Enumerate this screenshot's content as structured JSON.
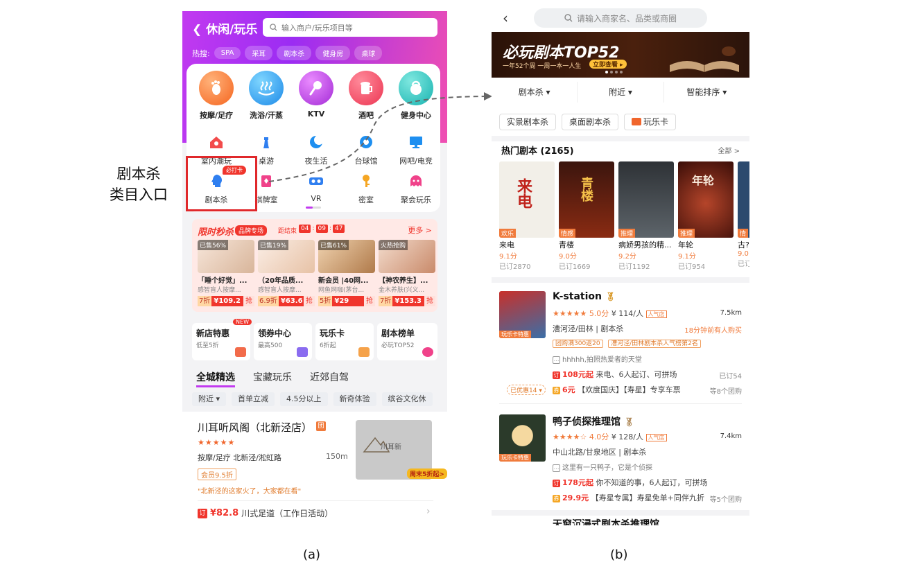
{
  "captions": {
    "left": "(a)",
    "right": "(b)"
  },
  "annotation": {
    "line1": "剧本杀",
    "line2": "类目入口"
  },
  "left": {
    "title": "休闲/玩乐",
    "search_placeholder": "输入商户/玩乐项目等",
    "hot_label": "热搜:",
    "hot_tags": [
      "SPA",
      "采耳",
      "剧本杀",
      "健身房",
      "桌球"
    ],
    "big_categories": [
      "按摩/足疗",
      "洗浴/汗蒸",
      "KTV",
      "酒吧",
      "健身中心"
    ],
    "small_row1": [
      "室内潮玩",
      "桌游",
      "夜生活",
      "台球馆",
      "网吧/电竞"
    ],
    "small_row2": [
      "剧本杀",
      "棋牌室",
      "VR",
      "密室",
      "聚会玩乐"
    ],
    "hot_badge": "必打卡",
    "flash": {
      "title": "限时秒杀",
      "brand": "品牌专场",
      "dist": "距结束",
      "time": [
        "04",
        "09",
        "47"
      ],
      "more": "更多 >",
      "deals": [
        {
          "sold": "已售56%",
          "t": "「睡个好觉」...",
          "s": "感智盲人按摩...",
          "d": "7折",
          "v": "¥109.2",
          "q": "抢"
        },
        {
          "sold": "已售19%",
          "t": "（20年品质...",
          "s": "感智盲人按摩...",
          "d": "6.9折",
          "v": "¥63.6",
          "q": "抢"
        },
        {
          "sold": "已售61%",
          "t": "新会员 |40网...",
          "s": "网鱼网咖(茅台...",
          "d": "5折",
          "v": "¥29",
          "q": "抢"
        },
        {
          "sold": "火热抢购",
          "t": "【神农养生】...",
          "s": "金木养肤(兴义...",
          "d": "7折",
          "v": "¥153.3",
          "q": "抢"
        }
      ]
    },
    "mini_cards": [
      {
        "t": "新店特惠",
        "s": "低至5折",
        "badge": "NEW"
      },
      {
        "t": "领券中心",
        "s": "最高500"
      },
      {
        "t": "玩乐卡",
        "s": "6折起"
      },
      {
        "t": "剧本榜单",
        "s": "必玩TOP52"
      }
    ],
    "tabs": [
      "全城精选",
      "宝藏玩乐",
      "近郊自驾"
    ],
    "filters": [
      "附近 ▾",
      "首单立减",
      "4.5分以上",
      "新奇体验",
      "缤谷文化休"
    ],
    "shop": {
      "name": "川耳听风阁（北新泾店）",
      "tuan": "团",
      "stars": "★★★★★",
      "category": "按摩/足疗 北新泾/淞虹路",
      "distance": "150m",
      "vip": "会员9.5折",
      "quote": "\"北新泾的这家火了，大家都在看\"",
      "img_logo": "川耳新",
      "weekend": "周末5折起>",
      "deal_price": "¥82.8",
      "deal_text": "川式足道（工作日活动）",
      "ding": "订"
    }
  },
  "right": {
    "search_placeholder": "请输入商家名、品类或商圈",
    "banner": {
      "title": "必玩剧本TOP52",
      "sub": "一年52个周 一周一本一人生",
      "btn": "立即查看 ▸"
    },
    "sort": [
      "剧本杀 ▾",
      "附近 ▾",
      "智能排序 ▾"
    ],
    "chips": [
      "实景剧本杀",
      "桌面剧本杀",
      "玩乐卡"
    ],
    "hot_title": "热门剧本 (2165)",
    "hot_all": "全部 >",
    "posters": [
      {
        "n": "来电",
        "sc": "9.1分",
        "cnt": "已订2870",
        "tag": "欢乐",
        "color": "#f2efe8",
        "txt": "来电"
      },
      {
        "n": "青楼",
        "sc": "9.0分",
        "cnt": "已订1669",
        "tag": "情感",
        "color": "#3b150e",
        "txt": "青楼"
      },
      {
        "n": "病娇男孩的精...",
        "sc": "9.2分",
        "cnt": "已订1192",
        "tag": "推理",
        "color": "#2e3236",
        "txt": ""
      },
      {
        "n": "年轮",
        "sc": "9.1分",
        "cnt": "已订954",
        "tag": "推理",
        "color": "#5a1a12",
        "txt": "年轮"
      },
      {
        "n": "古?",
        "sc": "9.0",
        "cnt": "已订",
        "tag": "情",
        "color": "#2c4a6e",
        "txt": ""
      }
    ],
    "shops": [
      {
        "name": "K-station",
        "stars": "★★★★★",
        "score": "5.0分",
        "price": "¥ 114/人",
        "rq": "人气店",
        "dist": "7.5km",
        "area": "漕河泾/田林 | 剧本杀",
        "recent": "18分钟前有人购买",
        "pills": [
          "团购满300返20",
          "漕河泾/田林剧本杀人气榜第2名"
        ],
        "comment": "hhhhh,拍照热爱者的天堂",
        "deal1_price": "108元起",
        "deal1_text": "来电、6人起订、可拼场",
        "deal1_sold": "已订54",
        "coupon": "已优惠14 ▾",
        "deal2_price": "6元",
        "deal2_text": "【欢度国庆】【寿星】专享车票",
        "deal2_more": "等8个团购",
        "ribbon": "玩乐卡特惠"
      },
      {
        "name": "鸭子侦探推理馆",
        "stars": "★★★★☆",
        "score": "4.0分",
        "price": "¥ 128/人",
        "rq": "人气店",
        "dist": "7.4km",
        "area": "中山北路/甘泉地区 | 剧本杀",
        "comment": "这里有一只鸭子，它是个侦探",
        "deal1_price": "178元起",
        "deal1_text": "你不知道的事，6人起订，可拼场",
        "deal2_price": "29.9元",
        "deal2_text": "【寿星专属】寿星免单+同伴九折",
        "deal2_more": "等5个团购",
        "ribbon": "玩乐卡特惠"
      }
    ],
    "third_shop": "天窗沉浸式剧本杀推理馆"
  },
  "colors": {
    "accent_purple": "#c23af0",
    "accent_red": "#f0352c",
    "accent_orange": "#f07b3c",
    "annotation_red": "#e0282b"
  }
}
